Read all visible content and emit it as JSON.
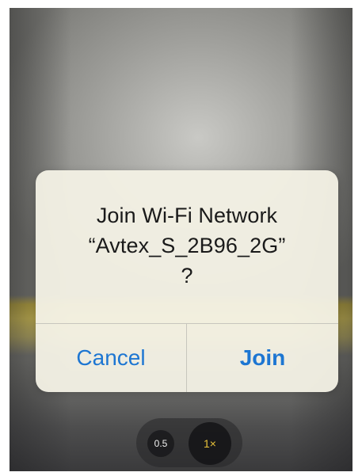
{
  "alert": {
    "title_line1": "Join Wi-Fi Network",
    "title_line2": "“Avtex_S_2B96_2G”",
    "title_line3": "?",
    "cancel_label": "Cancel",
    "join_label": "Join"
  },
  "camera": {
    "zoom_options": [
      "0.5",
      "1×"
    ],
    "selected_zoom": "1×"
  },
  "colors": {
    "accent": "#1d76d2",
    "zoom_selected": "#e8c23a"
  }
}
